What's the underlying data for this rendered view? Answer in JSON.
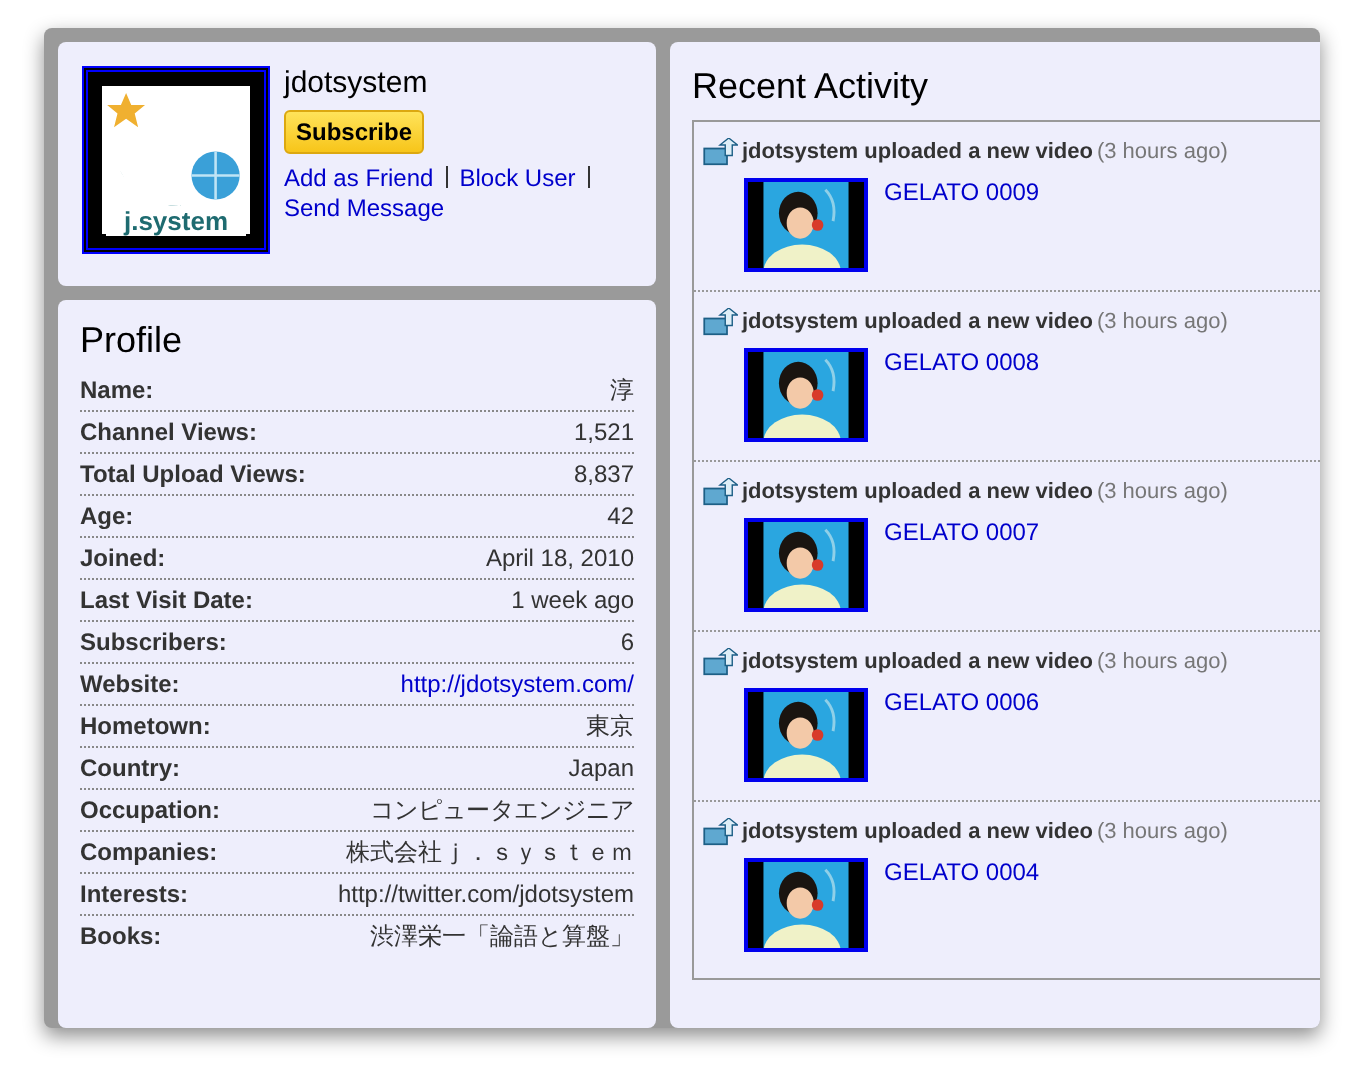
{
  "channel": {
    "username": "jdotsystem",
    "logo_text": "j.system",
    "subscribe": "Subscribe",
    "links": [
      "Add as Friend",
      "Block User",
      "Send Message"
    ]
  },
  "profile": {
    "title": "Profile",
    "rows": [
      {
        "label": "Name:",
        "value": "淳",
        "kind": "text"
      },
      {
        "label": "Channel Views:",
        "value": "1,521",
        "kind": "text"
      },
      {
        "label": "Total Upload Views:",
        "value": "8,837",
        "kind": "text"
      },
      {
        "label": "Age:",
        "value": "42",
        "kind": "text"
      },
      {
        "label": "Joined:",
        "value": "April 18, 2010",
        "kind": "text"
      },
      {
        "label": "Last Visit Date:",
        "value": "1 week ago",
        "kind": "text"
      },
      {
        "label": "Subscribers:",
        "value": "6",
        "kind": "text"
      },
      {
        "label": "Website:",
        "value": "http://jdotsystem.com/",
        "kind": "link"
      },
      {
        "label": "Hometown:",
        "value": "東京",
        "kind": "text"
      },
      {
        "label": "Country:",
        "value": "Japan",
        "kind": "text"
      },
      {
        "label": "Occupation:",
        "value": "コンピュータエンジニア",
        "kind": "text"
      },
      {
        "label": "Companies:",
        "value": "株式会社ｊ．ｓｙｓｔｅｍ",
        "kind": "text"
      },
      {
        "label": "Interests:",
        "value": "http://twitter.com/jdotsystem",
        "kind": "text"
      },
      {
        "label": "Books:",
        "value": "渋澤栄一「論語と算盤」",
        "kind": "text"
      }
    ]
  },
  "recent_activity": {
    "title": "Recent Activity",
    "items": [
      {
        "action": "jdotsystem uploaded a new video",
        "time": "(3 hours ago)",
        "video_title": "GELATO 0009"
      },
      {
        "action": "jdotsystem uploaded a new video",
        "time": "(3 hours ago)",
        "video_title": "GELATO 0008"
      },
      {
        "action": "jdotsystem uploaded a new video",
        "time": "(3 hours ago)",
        "video_title": "GELATO 0007"
      },
      {
        "action": "jdotsystem uploaded a new video",
        "time": "(3 hours ago)",
        "video_title": "GELATO 0006"
      },
      {
        "action": "jdotsystem uploaded a new video",
        "time": "(3 hours ago)",
        "video_title": "GELATO 0004"
      }
    ]
  }
}
